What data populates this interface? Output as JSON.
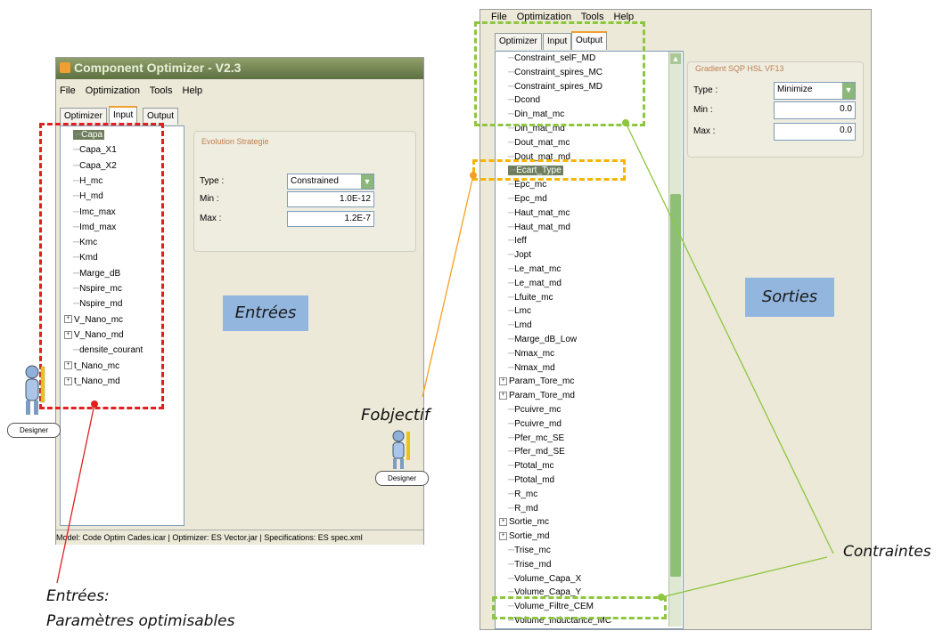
{
  "left_window": {
    "title": "Component Optimizer - V2.3",
    "menu": [
      "File",
      "Optimization",
      "Tools",
      "Help"
    ],
    "tabs": [
      "Optimizer",
      "Input",
      "Output"
    ],
    "active_tab": "Input",
    "tree": [
      {
        "label": "Capa",
        "selected": true,
        "expandable": false
      },
      {
        "label": "Capa_X1",
        "expandable": false
      },
      {
        "label": "Capa_X2",
        "expandable": false
      },
      {
        "label": "H_mc",
        "expandable": false
      },
      {
        "label": "H_md",
        "expandable": false
      },
      {
        "label": "Imc_max",
        "expandable": false
      },
      {
        "label": "Imd_max",
        "expandable": false
      },
      {
        "label": "Kmc",
        "expandable": false
      },
      {
        "label": "Kmd",
        "expandable": false
      },
      {
        "label": "Marge_dB",
        "expandable": false
      },
      {
        "label": "Nspire_mc",
        "expandable": false
      },
      {
        "label": "Nspire_md",
        "expandable": false
      },
      {
        "label": "V_Nano_mc",
        "expandable": true
      },
      {
        "label": "V_Nano_md",
        "expandable": true
      },
      {
        "label": "densite_courant",
        "expandable": false
      },
      {
        "label": "t_Nano_mc",
        "expandable": true
      },
      {
        "label": "t_Nano_md",
        "expandable": true
      }
    ],
    "group_title": "Evolution Strategie",
    "type_label": "Type :",
    "type_value": "Constrained",
    "min_label": "Min :",
    "min_value": "1.0E-12",
    "max_label": "Max :",
    "max_value": "1.2E-7",
    "status": "Model: Code Optim Cades.icar | Optimizer: ES Vector.jar | Specifications: ES spec.xml"
  },
  "right_window": {
    "menu": [
      "File",
      "Optimization",
      "Tools",
      "Help"
    ],
    "tabs": [
      "Optimizer",
      "Input",
      "Output"
    ],
    "active_tab": "Output",
    "tree": [
      {
        "label": "Constraint_selF_MD",
        "expandable": false
      },
      {
        "label": "Constraint_spires_MC",
        "expandable": false
      },
      {
        "label": "Constraint_spires_MD",
        "expandable": false
      },
      {
        "label": "Dcond",
        "expandable": false
      },
      {
        "label": "Din_mat_mc",
        "expandable": false
      },
      {
        "label": "Din_mat_md",
        "expandable": false
      },
      {
        "label": "Dout_mat_mc",
        "expandable": false
      },
      {
        "label": "Dout_mat_md",
        "expandable": false
      },
      {
        "label": "Ecart_Type",
        "selected": true,
        "expandable": false
      },
      {
        "label": "Epc_mc",
        "expandable": false
      },
      {
        "label": "Epc_md",
        "expandable": false
      },
      {
        "label": "Haut_mat_mc",
        "expandable": false
      },
      {
        "label": "Haut_mat_md",
        "expandable": false
      },
      {
        "label": "Ieff",
        "expandable": false
      },
      {
        "label": "Jopt",
        "expandable": false
      },
      {
        "label": "Le_mat_mc",
        "expandable": false
      },
      {
        "label": "Le_mat_md",
        "expandable": false
      },
      {
        "label": "Lfuite_mc",
        "expandable": false
      },
      {
        "label": "Lmc",
        "expandable": false
      },
      {
        "label": "Lmd",
        "expandable": false
      },
      {
        "label": "Marge_dB_Low",
        "expandable": false
      },
      {
        "label": "Nmax_mc",
        "expandable": false
      },
      {
        "label": "Nmax_md",
        "expandable": false
      },
      {
        "label": "Param_Tore_mc",
        "expandable": true
      },
      {
        "label": "Param_Tore_md",
        "expandable": true
      },
      {
        "label": "Pcuivre_mc",
        "expandable": false
      },
      {
        "label": "Pcuivre_md",
        "expandable": false
      },
      {
        "label": "Pfer_mc_SE",
        "expandable": false
      },
      {
        "label": "Pfer_md_SE",
        "expandable": false
      },
      {
        "label": "Ptotal_mc",
        "expandable": false
      },
      {
        "label": "Ptotal_md",
        "expandable": false
      },
      {
        "label": "R_mc",
        "expandable": false
      },
      {
        "label": "R_md",
        "expandable": false
      },
      {
        "label": "Sortie_mc",
        "expandable": true
      },
      {
        "label": "Sortie_md",
        "expandable": true
      },
      {
        "label": "Trise_mc",
        "expandable": false
      },
      {
        "label": "Trise_md",
        "expandable": false
      },
      {
        "label": "Volume_Capa_X",
        "expandable": false
      },
      {
        "label": "Volume_Capa_Y",
        "expandable": false
      },
      {
        "label": "Volume_Filtre_CEM",
        "expandable": false
      },
      {
        "label": "Volume_Inductance_MC",
        "expandable": false
      }
    ],
    "group_title": "Gradient SQP HSL VF13",
    "type_label": "Type :",
    "type_value": "Minimize",
    "min_label": "Min :",
    "min_value": "0.0",
    "max_label": "Max :",
    "max_value": "0.0"
  },
  "annotations": {
    "entrees_box": "Entrées",
    "sorties_box": "Sorties",
    "fobjectif": "Fobjectif",
    "contraintes": "Contraintes",
    "entrees_caption_line1": "Entrées:",
    "entrees_caption_line2": "Paramètres optimisables",
    "designer_label": "Designer"
  },
  "colors": {
    "red_dash": "#e02020",
    "green_dash": "#8dc63f",
    "orange_dash": "#f5b400",
    "label_box": "#93b6df"
  }
}
